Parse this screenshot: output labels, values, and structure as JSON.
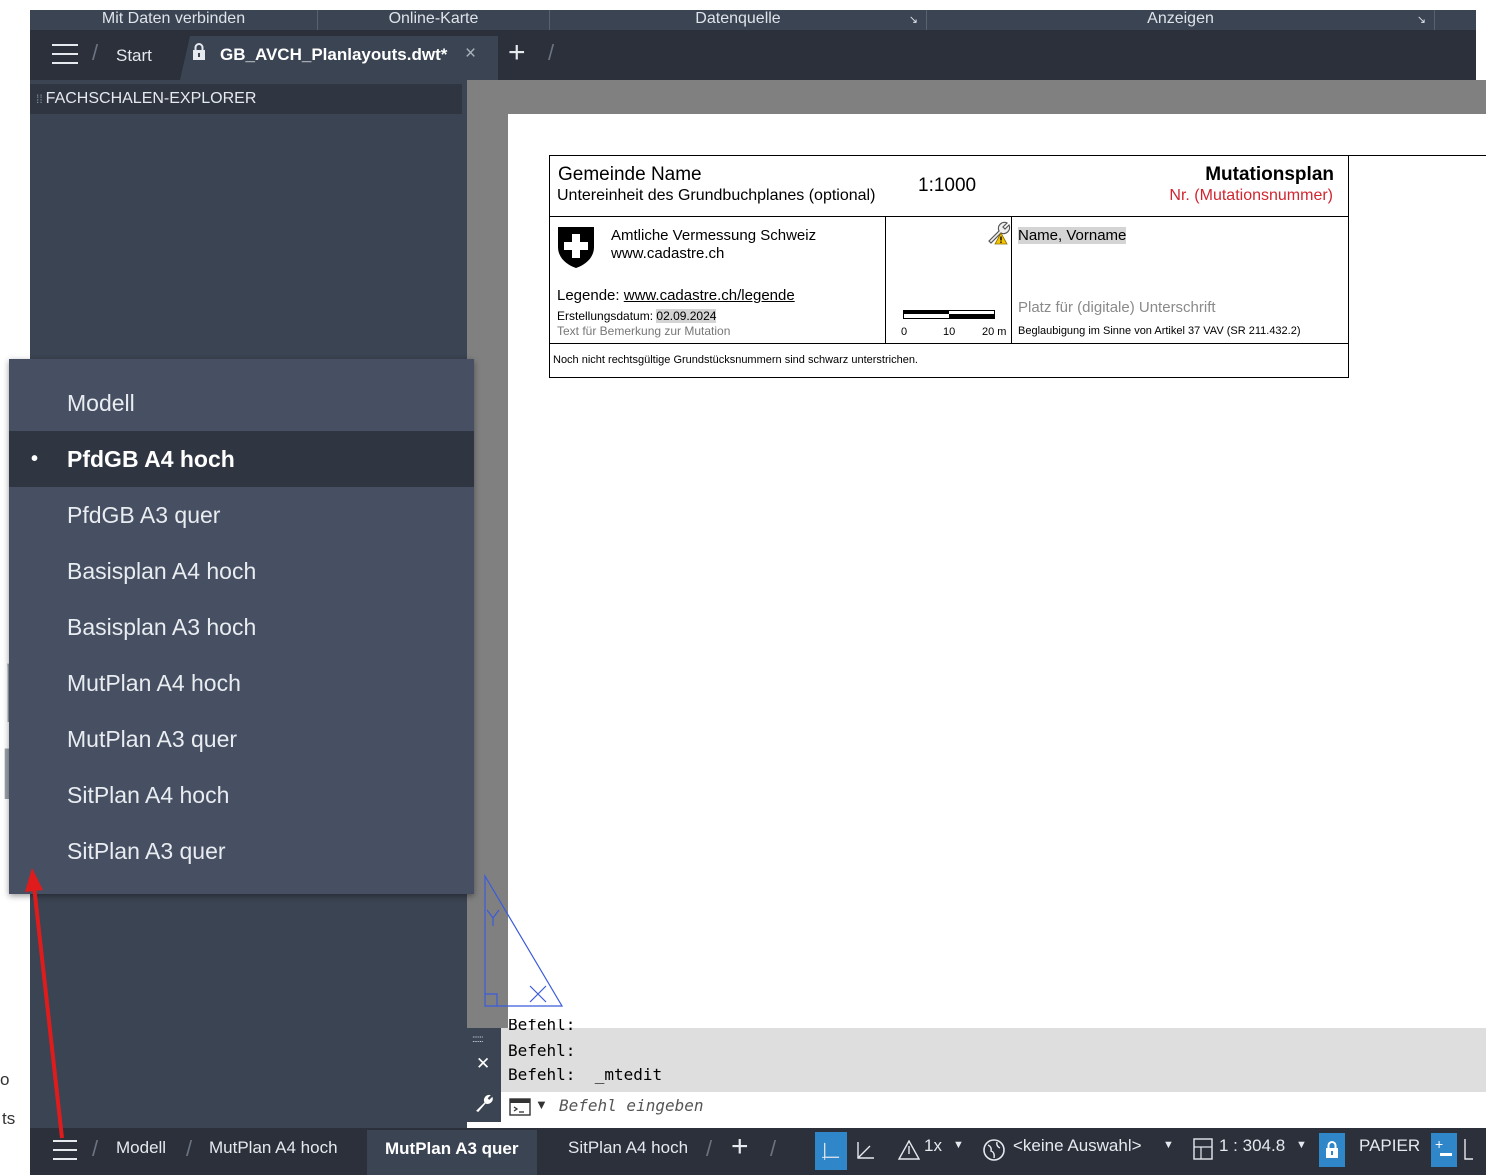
{
  "ribbon": {
    "panels": [
      "Mit Daten verbinden",
      "Online-Karte",
      "Datenquelle",
      "Anzeigen"
    ]
  },
  "file_tabs": {
    "start_label": "Start",
    "active_doc": "GB_AVCH_Planlayouts.dwt*",
    "close_symbol": "×",
    "new_tab_symbol": "+"
  },
  "palette": {
    "title": "FACHSCHALEN-EXPLORER",
    "grip": "⁞⁞"
  },
  "title_block": {
    "municipality": "Gemeinde Name",
    "subunit": "Untereinheit des Grundbuchplanes (optional)",
    "scale": "1:1000",
    "plan_title": "Mutationsplan",
    "plan_number": "Nr. (Mutationsnummer)",
    "agency_line1": "Amtliche Vermessung Schweiz",
    "agency_line2": "www.cadastre.ch",
    "legend_label": "Legende:",
    "legend_link": "www.cadastre.ch/legende",
    "date_label": "Erstellungsdatum:",
    "date_value": "02.09.2024",
    "remark": "Text für Bemerkung zur Mutation",
    "scalebar_labels": [
      "0",
      "10",
      "20 m"
    ],
    "signer": "Name, Vorname",
    "signature_placeholder": "Platz für (digitale) Unterschrift",
    "certification": "Beglaubigung im Sinne von Artikel 37 VAV (SR 211.432.2)",
    "footnote": "Noch nicht rechtsgültige Grundstücksnummern sind schwarz unterstrichen."
  },
  "layout_menu": {
    "items": [
      {
        "label": "Modell",
        "selected": false
      },
      {
        "label": "PfdGB A4 hoch",
        "selected": true
      },
      {
        "label": "PfdGB A3 quer",
        "selected": false
      },
      {
        "label": "Basisplan A4 hoch",
        "selected": false
      },
      {
        "label": "Basisplan A3 hoch",
        "selected": false
      },
      {
        "label": "MutPlan A4 hoch",
        "selected": false
      },
      {
        "label": "MutPlan A3 quer",
        "selected": false
      },
      {
        "label": "SitPlan A4 hoch",
        "selected": false
      },
      {
        "label": "SitPlan A3 quer",
        "selected": false
      }
    ],
    "selected_marker": "•"
  },
  "command_line": {
    "history_partial": "Befehl:",
    "history": [
      "Befehl:",
      "Befehl:  _mtedit"
    ],
    "placeholder": "Befehl eingeben",
    "close_symbol": "✕",
    "grip": "::::::"
  },
  "status_bar": {
    "layout_tabs": [
      "Modell",
      "MutPlan A4 hoch",
      "MutPlan A3 quer",
      "SitPlan A4 hoch"
    ],
    "active_layout": "MutPlan A3 quer",
    "add_symbol": "+",
    "isolate_label": "1x",
    "selection_label": "<keine Auswahl>",
    "scale_label": "1 : 304.8",
    "space_label": "PAPIER"
  },
  "background_fragments": {
    "big_glyph_1": "n",
    "big_glyph_2": "l",
    "edge_text_1": "o",
    "edge_text_2": "ts"
  },
  "colors": {
    "ribbon": "#3b4453",
    "tabbar": "#2b303a",
    "palette": "#3b4453",
    "menu": "#465062",
    "menu_selected": "#2f3541",
    "accent_red": "#d0262f",
    "ucs_blue": "#3b5bdb",
    "annotation_red": "#e01b1b",
    "status_blue": "#2f86c8"
  }
}
